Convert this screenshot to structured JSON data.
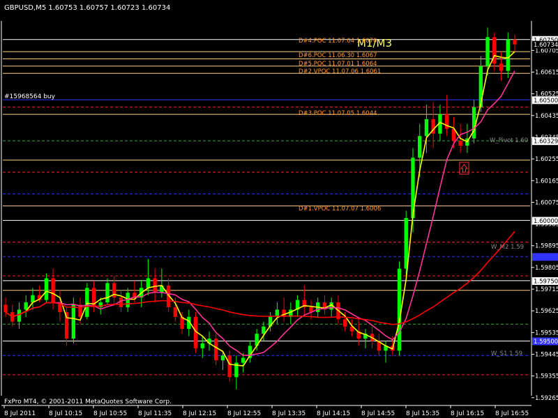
{
  "window": {
    "symbol_line": "GBPUSD,M5  1.60753 1.60757 1.60723 1.60734",
    "footer": "FxPro MT4, © 2001-2011 MetaQuotes Software Corp.",
    "big_label": "M1/M3"
  },
  "annotations": {
    "poc4": "D#4.POC 11.07.04 1.6070",
    "poc6": "D#6.POC 11.06.30 1.6067",
    "poc5": "D#5.POC 11.07.01 1.6064",
    "vpoc2": "D#2.VPOC 11.07.06 1.6061",
    "buy_order": "#15968564 buy",
    "poc3": "D#3.POC 11.07.05 1.6044",
    "w_pivot": "W_Pivot 1.60",
    "vpoc1": "D#1.VPOC 11.07.07 1.6006",
    "w_m2": "W_M2 1.59",
    "w_s1": "W_S1 1.59"
  },
  "colors": {
    "background": "#000000",
    "grid": "#3a3a3a",
    "bull_candle": "#00ff00",
    "bear_candle": "#ff0000",
    "ma_fast": "#ffff00",
    "ma_mid": "#ff3399",
    "ma_slow": "#ff0000",
    "poc_line": "#ffcc88",
    "orange_text": "#ff9933",
    "blue_line": "#3333ff",
    "white_line": "#ffffff",
    "green_dash": "#33aa33",
    "red_dash": "#ff2222"
  },
  "chart_data": {
    "type": "candlestick",
    "instrument": "GBPUSD",
    "timeframe": "M5",
    "price_axis": {
      "ticks": [
        "1.60750",
        "1.60705",
        "1.60615",
        "1.60525",
        "1.60435",
        "1.60345",
        "1.60255",
        "1.60165",
        "1.60075",
        "1.59985",
        "1.59895",
        "1.59805",
        "1.59715",
        "1.59625",
        "1.59535",
        "1.59445",
        "1.59355",
        "1.59265"
      ],
      "marked_levels": [
        "1.60750",
        "1.60500",
        "1.60329",
        "1.60250",
        "1.60000",
        "1.59750",
        "1.59500"
      ],
      "ylim": [
        1.5925,
        1.6081
      ]
    },
    "time_axis": {
      "labels": [
        "8 Jul 2011",
        "8 Jul 10:15",
        "8 Jul 10:55",
        "8 Jul 11:35",
        "8 Jul 12:15",
        "8 Jul 12:55",
        "8 Jul 13:35",
        "8 Jul 14:15",
        "8 Jul 14:55",
        "8 Jul 15:35",
        "8 Jul 16:15",
        "8 Jul 16:55"
      ]
    },
    "horizontal_levels": [
      {
        "price": 1.6075,
        "style": "solid",
        "color": "#ffffff"
      },
      {
        "price": 1.607,
        "style": "solid",
        "color": "#ffcc88"
      },
      {
        "price": 1.6067,
        "style": "solid",
        "color": "#ffcc88"
      },
      {
        "price": 1.6064,
        "style": "solid",
        "color": "#ffcc88"
      },
      {
        "price": 1.6061,
        "style": "solid",
        "color": "#ffcc88"
      },
      {
        "price": 1.605,
        "style": "solid",
        "color": "#3333ff"
      },
      {
        "price": 1.6047,
        "style": "dashed",
        "color": "#ff2222"
      },
      {
        "price": 1.6044,
        "style": "solid",
        "color": "#ffcc88"
      },
      {
        "price": 1.6033,
        "style": "dashed",
        "color": "#33aa33"
      },
      {
        "price": 1.6025,
        "style": "solid",
        "color": "#ffcc88"
      },
      {
        "price": 1.602,
        "style": "dashed",
        "color": "#ff2222"
      },
      {
        "price": 1.6011,
        "style": "dashed",
        "color": "#3333ff"
      },
      {
        "price": 1.6006,
        "style": "solid",
        "color": "#ffcc88"
      },
      {
        "price": 1.6,
        "style": "solid",
        "color": "#ffffff"
      },
      {
        "price": 1.5991,
        "style": "dashed",
        "color": "#ff2222"
      },
      {
        "price": 1.5985,
        "style": "dashed",
        "color": "#3333ff"
      },
      {
        "price": 1.5977,
        "style": "dashed",
        "color": "#ff2222"
      },
      {
        "price": 1.5975,
        "style": "solid",
        "color": "#ffffff"
      },
      {
        "price": 1.5971,
        "style": "solid",
        "color": "#ffcc88"
      },
      {
        "price": 1.5957,
        "style": "dashed",
        "color": "#33aa33"
      },
      {
        "price": 1.595,
        "style": "solid",
        "color": "#ffffff"
      },
      {
        "price": 1.5944,
        "style": "dashed",
        "color": "#3333ff"
      },
      {
        "price": 1.5936,
        "style": "dashed",
        "color": "#ff2222"
      }
    ],
    "price_markers": [
      {
        "price": 1.6075,
        "text": "1.60750",
        "bg": "#ffffff",
        "fg": "#000000"
      },
      {
        "price": 1.6073,
        "text": "1.60734",
        "bg": "#000000",
        "fg": "#ffffff"
      },
      {
        "price": 1.605,
        "text": "1.60500",
        "bg": "#ffffff",
        "fg": "#000000"
      },
      {
        "price": 1.6033,
        "text": "1.60329",
        "bg": "#ffffff",
        "fg": "#000000"
      },
      {
        "price": 1.6,
        "text": "1.60000",
        "bg": "#ffffff",
        "fg": "#000000"
      },
      {
        "price": 1.5985,
        "text": "",
        "bg": "#3333ff",
        "fg": "#ffffff"
      },
      {
        "price": 1.5975,
        "text": "1.59750",
        "bg": "#ffffff",
        "fg": "#000000"
      },
      {
        "price": 1.595,
        "text": "1.59500",
        "bg": "#3333ff",
        "fg": "#ffffff"
      }
    ],
    "candles": [
      [
        1.5965,
        1.5968,
        1.596,
        1.5962
      ],
      [
        1.5962,
        1.5965,
        1.5956,
        1.5958
      ],
      [
        1.5958,
        1.5966,
        1.5955,
        1.5963
      ],
      [
        1.5963,
        1.5969,
        1.596,
        1.5966
      ],
      [
        1.5966,
        1.5972,
        1.5963,
        1.5969
      ],
      [
        1.5969,
        1.5973,
        1.5966,
        1.5967
      ],
      [
        1.5967,
        1.5978,
        1.5966,
        1.5976
      ],
      [
        1.5976,
        1.598,
        1.5963,
        1.5966
      ],
      [
        1.5966,
        1.5971,
        1.5958,
        1.5962
      ],
      [
        1.5962,
        1.5964,
        1.5948,
        1.5951
      ],
      [
        1.5951,
        1.5968,
        1.5949,
        1.5965
      ],
      [
        1.5965,
        1.5968,
        1.5957,
        1.596
      ],
      [
        1.596,
        1.5974,
        1.5959,
        1.5972
      ],
      [
        1.5972,
        1.5975,
        1.5962,
        1.5964
      ],
      [
        1.5964,
        1.5968,
        1.5961,
        1.5966
      ],
      [
        1.5966,
        1.5976,
        1.5965,
        1.5974
      ],
      [
        1.5974,
        1.5977,
        1.5965,
        1.5968
      ],
      [
        1.5968,
        1.5971,
        1.5962,
        1.5964
      ],
      [
        1.5964,
        1.5972,
        1.5962,
        1.597
      ],
      [
        1.597,
        1.5975,
        1.5966,
        1.5968
      ],
      [
        1.5968,
        1.5975,
        1.5964,
        1.5972
      ],
      [
        1.5972,
        1.5984,
        1.5969,
        1.5976
      ],
      [
        1.5976,
        1.598,
        1.5966,
        1.597
      ],
      [
        1.597,
        1.598,
        1.5968,
        1.5973
      ],
      [
        1.5973,
        1.5976,
        1.5962,
        1.5964
      ],
      [
        1.5964,
        1.5968,
        1.5958,
        1.596
      ],
      [
        1.596,
        1.5962,
        1.5953,
        1.5955
      ],
      [
        1.5955,
        1.5963,
        1.5952,
        1.596
      ],
      [
        1.596,
        1.5962,
        1.5945,
        1.5947
      ],
      [
        1.5947,
        1.5952,
        1.5943,
        1.5949
      ],
      [
        1.5949,
        1.5954,
        1.5946,
        1.5951
      ],
      [
        1.5951,
        1.5953,
        1.594,
        1.5942
      ],
      [
        1.5942,
        1.5946,
        1.5938,
        1.5944
      ],
      [
        1.5944,
        1.5946,
        1.5933,
        1.5935
      ],
      [
        1.5935,
        1.5944,
        1.593,
        1.5941
      ],
      [
        1.5941,
        1.5945,
        1.5937,
        1.5943
      ],
      [
        1.5943,
        1.595,
        1.5941,
        1.5948
      ],
      [
        1.5948,
        1.5955,
        1.5946,
        1.5953
      ],
      [
        1.5953,
        1.5958,
        1.595,
        1.5956
      ],
      [
        1.5956,
        1.5962,
        1.5954,
        1.596
      ],
      [
        1.596,
        1.5966,
        1.5957,
        1.5963
      ],
      [
        1.5963,
        1.5968,
        1.5958,
        1.596
      ],
      [
        1.596,
        1.5966,
        1.5957,
        1.5963
      ],
      [
        1.5963,
        1.5969,
        1.596,
        1.5967
      ],
      [
        1.5967,
        1.5973,
        1.5961,
        1.5964
      ],
      [
        1.5964,
        1.5967,
        1.5959,
        1.5962
      ],
      [
        1.5962,
        1.5968,
        1.596,
        1.5966
      ],
      [
        1.5966,
        1.5969,
        1.5961,
        1.5963
      ],
      [
        1.5963,
        1.5968,
        1.596,
        1.5966
      ],
      [
        1.5966,
        1.5969,
        1.5957,
        1.5959
      ],
      [
        1.5959,
        1.5962,
        1.5954,
        1.5956
      ],
      [
        1.5956,
        1.5959,
        1.5952,
        1.5954
      ],
      [
        1.5954,
        1.5959,
        1.5948,
        1.5951
      ],
      [
        1.5951,
        1.5955,
        1.5947,
        1.5953
      ],
      [
        1.5953,
        1.5956,
        1.5947,
        1.595
      ],
      [
        1.595,
        1.5953,
        1.5944,
        1.5946
      ],
      [
        1.5946,
        1.595,
        1.5941,
        1.5948
      ],
      [
        1.5948,
        1.5952,
        1.5944,
        1.5946
      ],
      [
        1.5946,
        1.5983,
        1.5944,
        1.598
      ],
      [
        1.598,
        1.6004,
        1.5977,
        1.6001
      ],
      [
        1.6001,
        1.603,
        1.5995,
        1.6026
      ],
      [
        1.6026,
        1.604,
        1.6018,
        1.6035
      ],
      [
        1.6035,
        1.6048,
        1.6028,
        1.6042
      ],
      [
        1.6042,
        1.6049,
        1.603,
        1.6036
      ],
      [
        1.6036,
        1.6048,
        1.6033,
        1.6044
      ],
      [
        1.6044,
        1.6052,
        1.6035,
        1.6038
      ],
      [
        1.6038,
        1.6043,
        1.603,
        1.6033
      ],
      [
        1.6033,
        1.604,
        1.6028,
        1.6031
      ],
      [
        1.6031,
        1.604,
        1.6028,
        1.6034
      ],
      [
        1.6034,
        1.605,
        1.6032,
        1.6047
      ],
      [
        1.6047,
        1.6068,
        1.6045,
        1.6064
      ],
      [
        1.6064,
        1.608,
        1.606,
        1.6076
      ],
      [
        1.6076,
        1.6078,
        1.6062,
        1.6065
      ],
      [
        1.6065,
        1.607,
        1.6058,
        1.6062
      ],
      [
        1.6062,
        1.6078,
        1.6059,
        1.6075
      ],
      [
        1.6075,
        1.6077,
        1.607,
        1.6073
      ]
    ],
    "series": [
      {
        "type": "line",
        "color": "#ffff00"
      },
      {
        "type": "line",
        "color": "#ff3399"
      },
      {
        "type": "line",
        "color": "#ff0000"
      }
    ]
  }
}
